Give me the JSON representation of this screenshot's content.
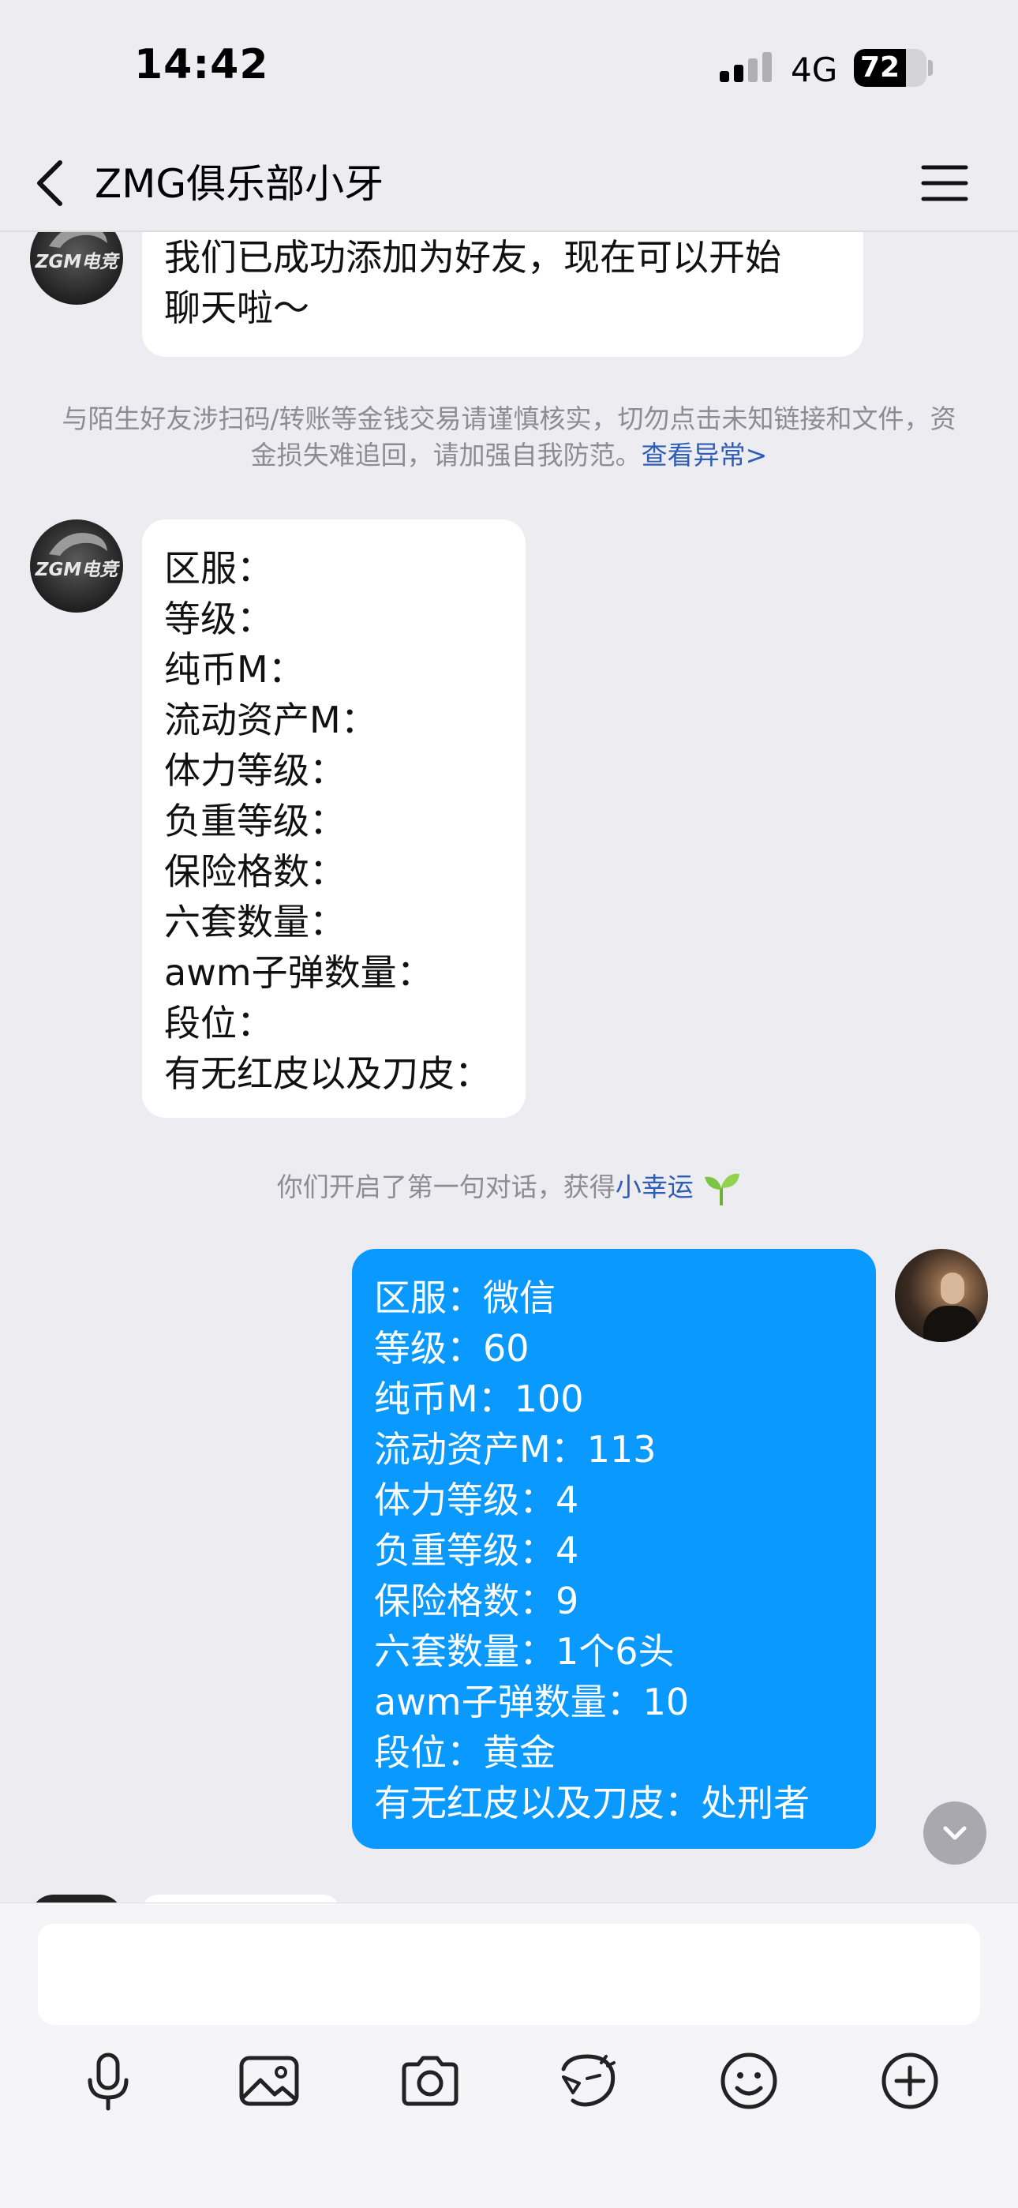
{
  "status_bar": {
    "time": "14:42",
    "network": "4G",
    "battery_level": "72",
    "battery_fraction": 0.72
  },
  "nav": {
    "title": "ZMG俱乐部小牙",
    "back_icon": "chevron-left-icon",
    "menu_icon": "hamburger-menu-icon"
  },
  "contact": {
    "avatar_text": "ZGM电竞"
  },
  "messages": {
    "first": {
      "lines": [
        "我们已成功添加为好友，现在可以开始",
        "聊天啦～"
      ]
    },
    "notice": {
      "text": "与陌生好友涉扫码/转账等金钱交易请谨慎核实，切勿点击未知链接和文件，资金损失难追回，请加强自我防范。",
      "link": "查看异常>"
    },
    "template": {
      "lines": [
        "区服：",
        "等级：",
        "纯币M：",
        "流动资产M：",
        "体力等级：",
        "负重等级：",
        "保险格数：",
        "六套数量：",
        "awm子弹数量：",
        "段位：",
        "有无红皮以及刀皮："
      ]
    },
    "system": {
      "text": "你们开启了第一句对话，获得",
      "link": "小幸运",
      "icon": "sprout-icon"
    },
    "reply": {
      "lines": [
        "区服：微信",
        "等级：60",
        "纯币M：100",
        "流动资产M：113",
        "体力等级：4",
        "负重等级：4",
        "保险格数：9",
        "六套数量：1个6头",
        "awm子弹数量：10",
        "段位：黄金",
        "有无红皮以及刀皮：处刑者"
      ]
    }
  },
  "input": {
    "value": "",
    "placeholder": ""
  },
  "toolbar": {
    "icons": [
      "microphone-icon",
      "image-icon",
      "camera-icon",
      "sticker-icon",
      "emoji-icon",
      "plus-icon"
    ]
  },
  "colors": {
    "outgoing_bubble": "#0a99ff",
    "incoming_bubble": "#ffffff",
    "background": "#ededf1",
    "link": "#2e5db8"
  }
}
